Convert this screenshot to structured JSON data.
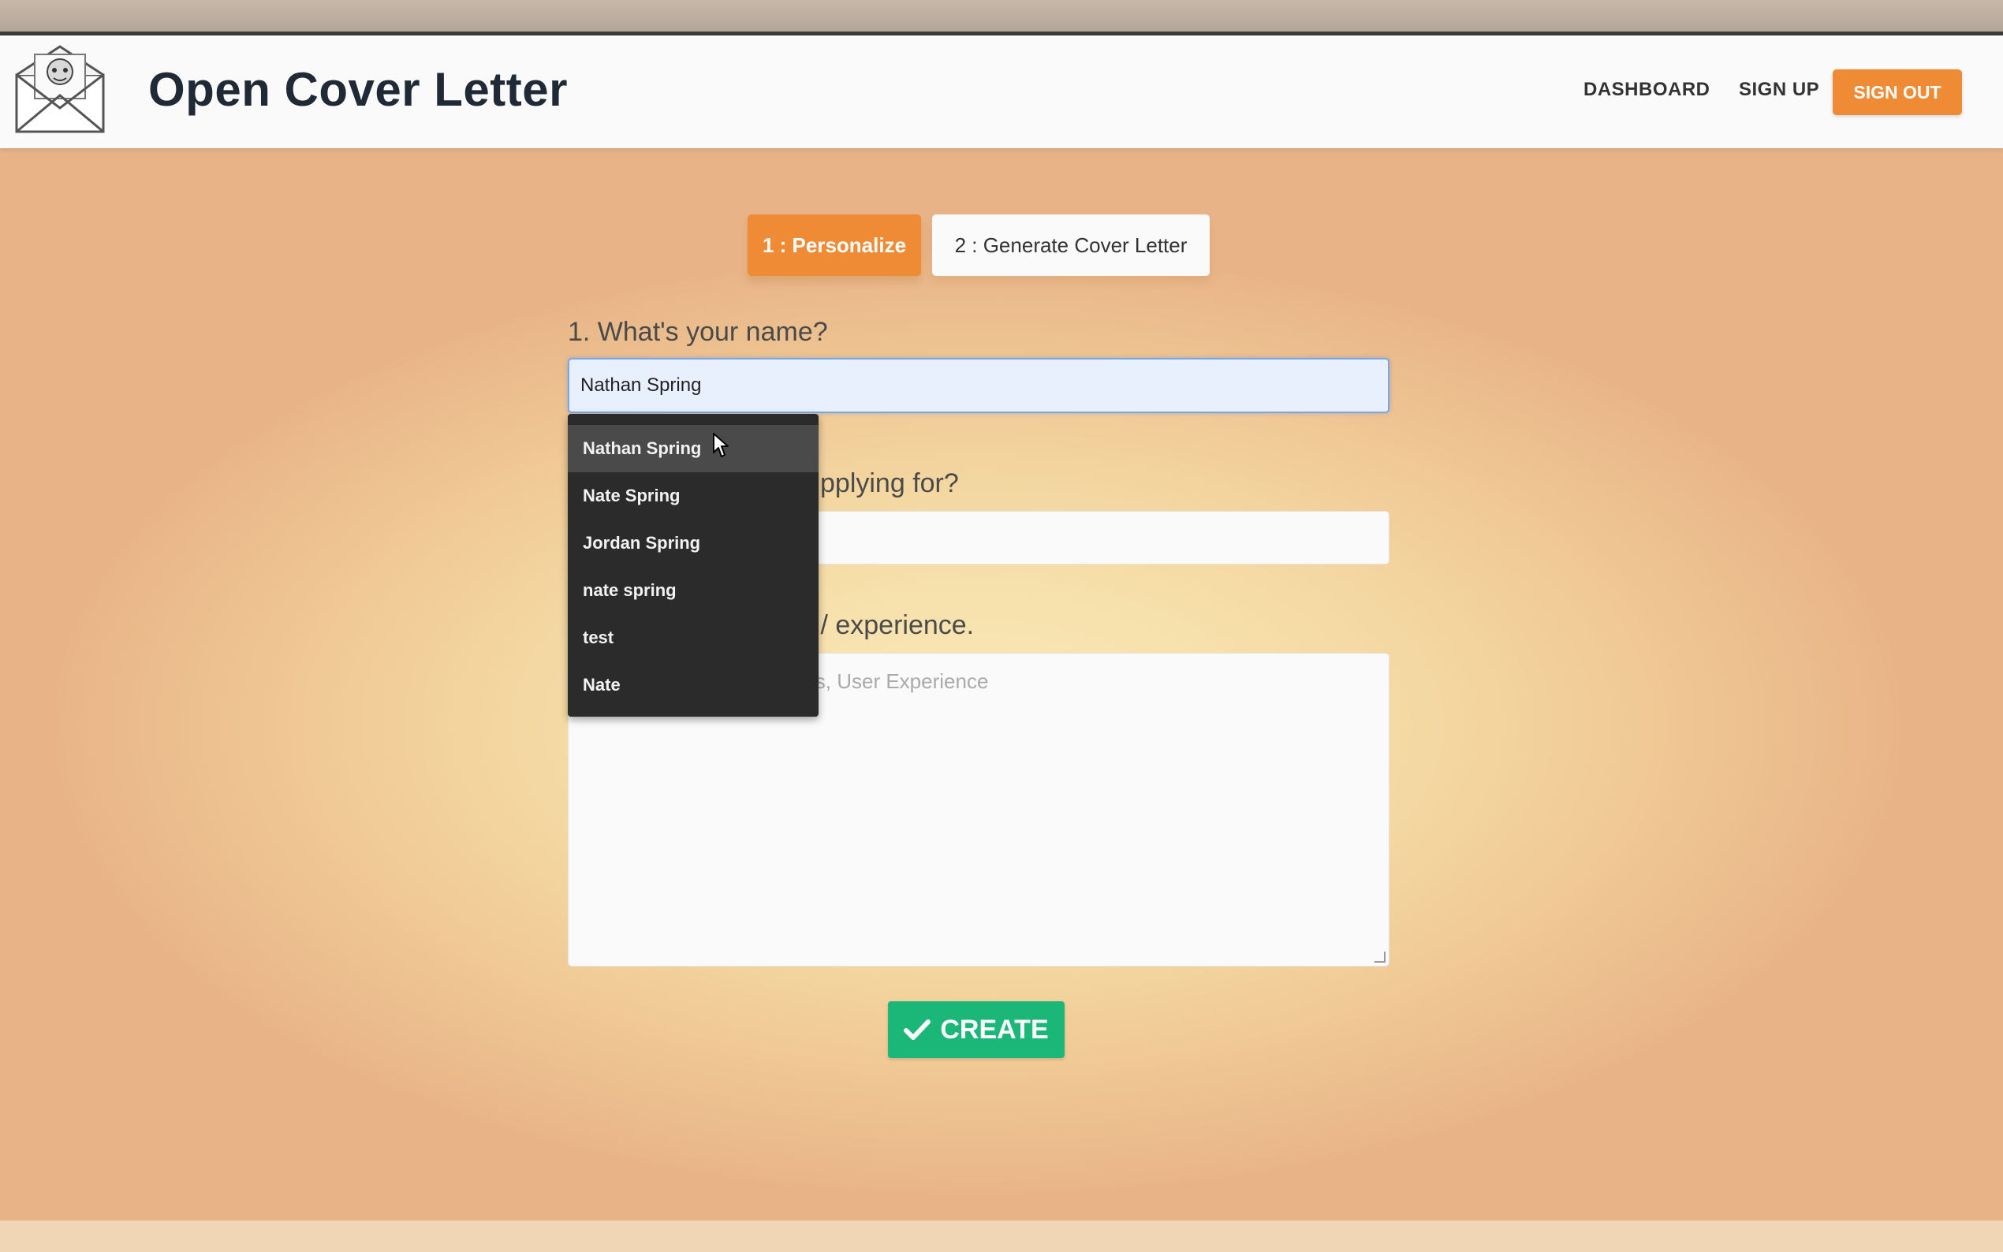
{
  "app": {
    "brand_title": "Open Cover Letter"
  },
  "nav": {
    "dashboard": "DASHBOARD",
    "sign_up": "SIGN UP",
    "sign_out": "SIGN OUT"
  },
  "steps": [
    {
      "label": "1 : Personalize",
      "active": true
    },
    {
      "label": "2 : Generate Cover Letter",
      "active": false
    }
  ],
  "form": {
    "name_label": "1. What's your name?",
    "name_value": "Nathan Spring",
    "job_label_visible": "pplying for?",
    "skills_label_visible": "s / experience.",
    "skills_placeholder_visible": "sis, User Experience"
  },
  "autocomplete": {
    "items": [
      "Nathan Spring",
      "Nate Spring",
      "Jordan Spring",
      "nate spring",
      "test",
      "Nate"
    ],
    "highlighted_index": 0
  },
  "create_button": {
    "label": "CREATE",
    "icon": "check-icon"
  },
  "colors": {
    "accent_orange": "#ef8a35",
    "create_green": "#1ab779",
    "brand_dark": "#1f2a36",
    "dropdown_bg": "#2b2b2b"
  }
}
